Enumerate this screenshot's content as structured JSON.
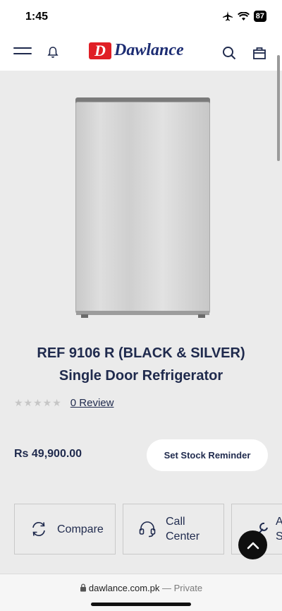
{
  "status": {
    "time": "1:45",
    "battery": "87"
  },
  "header": {
    "brand": "Dawlance",
    "logo_letter": "D"
  },
  "product": {
    "title_line1": "REF 9106 R (BLACK & SILVER)",
    "title_line2": "Single Door Refrigerator",
    "rating_stars": "★★★★★",
    "rating_value": 0,
    "review_link": "0 Review",
    "price": "Rs 49,900.00",
    "reminder_button": "Set Stock Reminder"
  },
  "actions": [
    {
      "label": "Compare",
      "icon": "refresh-arrows-icon"
    },
    {
      "label": "Call Center",
      "icon": "headset-icon"
    },
    {
      "label": "Au Se",
      "icon": "wrench-icon"
    }
  ],
  "browser": {
    "domain": "dawlance.com.pk",
    "separator": " — ",
    "mode": "Private"
  },
  "colors": {
    "brand_navy": "#1f2a4d",
    "brand_red": "#e01f26",
    "background": "#ebebeb"
  }
}
